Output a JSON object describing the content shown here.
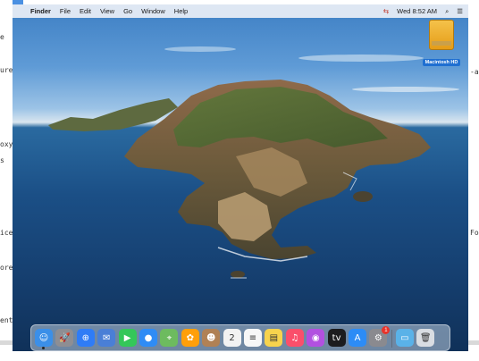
{
  "background_text": {
    "left": [
      "e",
      "ure",
      "oxy",
      "s",
      "ice",
      "ore",
      "ent"
    ],
    "right": [
      "-a",
      "Fo"
    ]
  },
  "menubar": {
    "apple_glyph": "",
    "items": [
      "Finder",
      "File",
      "Edit",
      "View",
      "Go",
      "Window",
      "Help"
    ],
    "clock": "Wed 8:52 AM",
    "search_glyph": "⌕",
    "control_glyph": "☰",
    "status_glyph": "⇆"
  },
  "desktop": {
    "hd_label": "Macintosh HD"
  },
  "dock": {
    "apps": [
      {
        "name": "finder-icon",
        "glyph": "☺",
        "color": "#3b8fe8"
      },
      {
        "name": "launchpad-icon",
        "glyph": "🚀",
        "color": "#8e8e93"
      },
      {
        "name": "safari-icon",
        "glyph": "⊕",
        "color": "#2f7cf6"
      },
      {
        "name": "mail-icon",
        "glyph": "✉",
        "color": "#4a7fd6"
      },
      {
        "name": "facetime-icon",
        "glyph": "▶",
        "color": "#34c759"
      },
      {
        "name": "messages-icon",
        "glyph": "●",
        "color": "#2f8cf5"
      },
      {
        "name": "maps-icon",
        "glyph": "⌖",
        "color": "#6dbb5f"
      },
      {
        "name": "photos-icon",
        "glyph": "✿",
        "color": "#ff9f0a"
      },
      {
        "name": "contacts-icon",
        "glyph": "☻",
        "color": "#b08155"
      },
      {
        "name": "calendar-icon",
        "glyph": "2",
        "color": "#f2f2f2"
      },
      {
        "name": "reminders-icon",
        "glyph": "≡",
        "color": "#f7f7f7"
      },
      {
        "name": "notes-icon",
        "glyph": "▤",
        "color": "#f7d34d"
      },
      {
        "name": "music-icon",
        "glyph": "♫",
        "color": "#fa4f6b"
      },
      {
        "name": "podcasts-icon",
        "glyph": "◉",
        "color": "#b250e0"
      },
      {
        "name": "tv-icon",
        "glyph": "tv",
        "color": "#1c1c1e"
      },
      {
        "name": "app-store-icon",
        "glyph": "A",
        "color": "#2c8cf6"
      },
      {
        "name": "system-preferences-icon",
        "glyph": "⚙",
        "color": "#8a8a8f",
        "badge": "1"
      }
    ],
    "folders": [
      {
        "name": "downloads-folder-icon",
        "glyph": "▭",
        "color": "#5ab2e8"
      },
      {
        "name": "trash-icon",
        "glyph": "🗑",
        "color": "#d9dde2"
      }
    ]
  }
}
